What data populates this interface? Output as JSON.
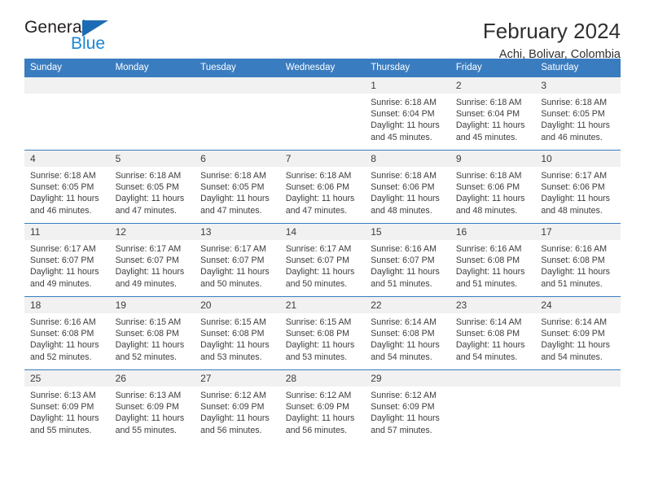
{
  "brand": {
    "name_part1": "General",
    "name_part2": "Blue",
    "triangle_color": "#1c6cb5",
    "blue_text_color": "#1b87d4"
  },
  "header": {
    "month_title": "February 2024",
    "location": "Achi, Bolivar, Colombia"
  },
  "theme": {
    "header_blue": "#3a7cc0",
    "daynum_band": "#f1f1f1",
    "text": "#3c3c3c"
  },
  "weekday_headers": [
    "Sunday",
    "Monday",
    "Tuesday",
    "Wednesday",
    "Thursday",
    "Friday",
    "Saturday"
  ],
  "labels": {
    "sunrise_prefix": "Sunrise:",
    "sunset_prefix": "Sunset:",
    "daylight_prefix": "Daylight:"
  },
  "weeks": [
    [
      {
        "day": "",
        "empty": true
      },
      {
        "day": "",
        "empty": true
      },
      {
        "day": "",
        "empty": true
      },
      {
        "day": "",
        "empty": true
      },
      {
        "day": "1",
        "sunrise": "Sunrise: 6:18 AM",
        "sunset": "Sunset: 6:04 PM",
        "daylight": "Daylight: 11 hours and 45 minutes."
      },
      {
        "day": "2",
        "sunrise": "Sunrise: 6:18 AM",
        "sunset": "Sunset: 6:04 PM",
        "daylight": "Daylight: 11 hours and 45 minutes."
      },
      {
        "day": "3",
        "sunrise": "Sunrise: 6:18 AM",
        "sunset": "Sunset: 6:05 PM",
        "daylight": "Daylight: 11 hours and 46 minutes."
      }
    ],
    [
      {
        "day": "4",
        "sunrise": "Sunrise: 6:18 AM",
        "sunset": "Sunset: 6:05 PM",
        "daylight": "Daylight: 11 hours and 46 minutes."
      },
      {
        "day": "5",
        "sunrise": "Sunrise: 6:18 AM",
        "sunset": "Sunset: 6:05 PM",
        "daylight": "Daylight: 11 hours and 47 minutes."
      },
      {
        "day": "6",
        "sunrise": "Sunrise: 6:18 AM",
        "sunset": "Sunset: 6:05 PM",
        "daylight": "Daylight: 11 hours and 47 minutes."
      },
      {
        "day": "7",
        "sunrise": "Sunrise: 6:18 AM",
        "sunset": "Sunset: 6:06 PM",
        "daylight": "Daylight: 11 hours and 47 minutes."
      },
      {
        "day": "8",
        "sunrise": "Sunrise: 6:18 AM",
        "sunset": "Sunset: 6:06 PM",
        "daylight": "Daylight: 11 hours and 48 minutes."
      },
      {
        "day": "9",
        "sunrise": "Sunrise: 6:18 AM",
        "sunset": "Sunset: 6:06 PM",
        "daylight": "Daylight: 11 hours and 48 minutes."
      },
      {
        "day": "10",
        "sunrise": "Sunrise: 6:17 AM",
        "sunset": "Sunset: 6:06 PM",
        "daylight": "Daylight: 11 hours and 48 minutes."
      }
    ],
    [
      {
        "day": "11",
        "sunrise": "Sunrise: 6:17 AM",
        "sunset": "Sunset: 6:07 PM",
        "daylight": "Daylight: 11 hours and 49 minutes."
      },
      {
        "day": "12",
        "sunrise": "Sunrise: 6:17 AM",
        "sunset": "Sunset: 6:07 PM",
        "daylight": "Daylight: 11 hours and 49 minutes."
      },
      {
        "day": "13",
        "sunrise": "Sunrise: 6:17 AM",
        "sunset": "Sunset: 6:07 PM",
        "daylight": "Daylight: 11 hours and 50 minutes."
      },
      {
        "day": "14",
        "sunrise": "Sunrise: 6:17 AM",
        "sunset": "Sunset: 6:07 PM",
        "daylight": "Daylight: 11 hours and 50 minutes."
      },
      {
        "day": "15",
        "sunrise": "Sunrise: 6:16 AM",
        "sunset": "Sunset: 6:07 PM",
        "daylight": "Daylight: 11 hours and 51 minutes."
      },
      {
        "day": "16",
        "sunrise": "Sunrise: 6:16 AM",
        "sunset": "Sunset: 6:08 PM",
        "daylight": "Daylight: 11 hours and 51 minutes."
      },
      {
        "day": "17",
        "sunrise": "Sunrise: 6:16 AM",
        "sunset": "Sunset: 6:08 PM",
        "daylight": "Daylight: 11 hours and 51 minutes."
      }
    ],
    [
      {
        "day": "18",
        "sunrise": "Sunrise: 6:16 AM",
        "sunset": "Sunset: 6:08 PM",
        "daylight": "Daylight: 11 hours and 52 minutes."
      },
      {
        "day": "19",
        "sunrise": "Sunrise: 6:15 AM",
        "sunset": "Sunset: 6:08 PM",
        "daylight": "Daylight: 11 hours and 52 minutes."
      },
      {
        "day": "20",
        "sunrise": "Sunrise: 6:15 AM",
        "sunset": "Sunset: 6:08 PM",
        "daylight": "Daylight: 11 hours and 53 minutes."
      },
      {
        "day": "21",
        "sunrise": "Sunrise: 6:15 AM",
        "sunset": "Sunset: 6:08 PM",
        "daylight": "Daylight: 11 hours and 53 minutes."
      },
      {
        "day": "22",
        "sunrise": "Sunrise: 6:14 AM",
        "sunset": "Sunset: 6:08 PM",
        "daylight": "Daylight: 11 hours and 54 minutes."
      },
      {
        "day": "23",
        "sunrise": "Sunrise: 6:14 AM",
        "sunset": "Sunset: 6:08 PM",
        "daylight": "Daylight: 11 hours and 54 minutes."
      },
      {
        "day": "24",
        "sunrise": "Sunrise: 6:14 AM",
        "sunset": "Sunset: 6:09 PM",
        "daylight": "Daylight: 11 hours and 54 minutes."
      }
    ],
    [
      {
        "day": "25",
        "sunrise": "Sunrise: 6:13 AM",
        "sunset": "Sunset: 6:09 PM",
        "daylight": "Daylight: 11 hours and 55 minutes."
      },
      {
        "day": "26",
        "sunrise": "Sunrise: 6:13 AM",
        "sunset": "Sunset: 6:09 PM",
        "daylight": "Daylight: 11 hours and 55 minutes."
      },
      {
        "day": "27",
        "sunrise": "Sunrise: 6:12 AM",
        "sunset": "Sunset: 6:09 PM",
        "daylight": "Daylight: 11 hours and 56 minutes."
      },
      {
        "day": "28",
        "sunrise": "Sunrise: 6:12 AM",
        "sunset": "Sunset: 6:09 PM",
        "daylight": "Daylight: 11 hours and 56 minutes."
      },
      {
        "day": "29",
        "sunrise": "Sunrise: 6:12 AM",
        "sunset": "Sunset: 6:09 PM",
        "daylight": "Daylight: 11 hours and 57 minutes."
      },
      {
        "day": "",
        "empty": true
      },
      {
        "day": "",
        "empty": true
      }
    ]
  ]
}
